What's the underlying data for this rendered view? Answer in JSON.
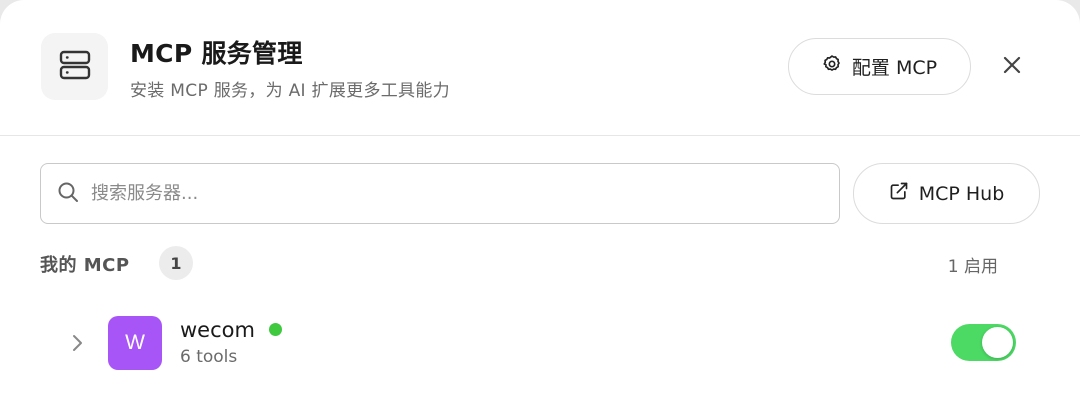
{
  "header": {
    "logo_icon": "server-icon",
    "title": "MCP 服务管理",
    "subtitle": "安装 MCP 服务，为 AI 扩展更多工具能力",
    "config_label": "配置 MCP",
    "config_icon": "gear-icon",
    "close_icon": "close-icon"
  },
  "search": {
    "placeholder": "搜索服务器...",
    "value": "",
    "icon": "search-icon"
  },
  "hub_button": {
    "label": "MCP Hub",
    "icon": "external-link-icon"
  },
  "section": {
    "label": "我的 MCP",
    "count": "1",
    "enabled_text": "1 启用"
  },
  "items": [
    {
      "avatar_letter": "W",
      "avatar_color": "#a855f7",
      "name": "wecom",
      "status_color": "#3fc93f",
      "tools": "6 tools",
      "enabled": true
    }
  ],
  "colors": {
    "toggle_on": "#4cd964",
    "border": "#dcdcdc"
  }
}
